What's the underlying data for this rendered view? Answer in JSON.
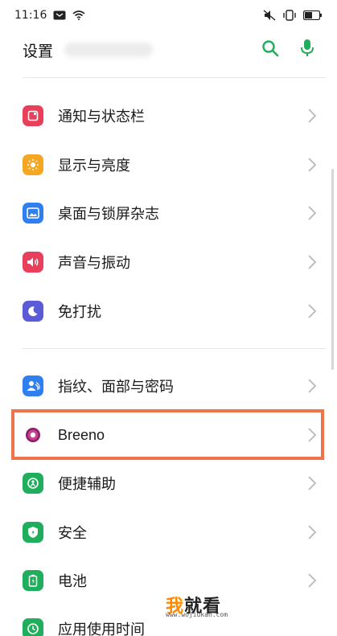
{
  "status_bar": {
    "time": "11:16",
    "icons": [
      "notification-icon",
      "wifi-icon",
      "mute-icon",
      "vibrate-icon",
      "battery-icon"
    ]
  },
  "header": {
    "title": "设置",
    "actions": [
      "search-icon",
      "mic-icon"
    ]
  },
  "accent_color": "#1fae5b",
  "highlight_color": "#f0744a",
  "settings": {
    "group1": [
      {
        "label": "通知与状态栏",
        "icon": "notification-bar-icon",
        "color": "#e8405a"
      },
      {
        "label": "显示与亮度",
        "icon": "sun-icon",
        "color": "#f5a623"
      },
      {
        "label": "桌面与锁屏杂志",
        "icon": "wallpaper-icon",
        "color": "#2f7ff0"
      },
      {
        "label": "声音与振动",
        "icon": "speaker-icon",
        "color": "#e8405a"
      },
      {
        "label": "免打扰",
        "icon": "moon-icon",
        "color": "#5b5bd6"
      }
    ],
    "group2": [
      {
        "label": "指纹、面部与密码",
        "icon": "fingerprint-face-icon",
        "color": "#2f7ff0"
      },
      {
        "label": "Breeno",
        "icon": "breeno-icon",
        "color": "#8a1d6e"
      },
      {
        "label": "便捷辅助",
        "icon": "accessibility-icon",
        "color": "#1fae5b"
      },
      {
        "label": "安全",
        "icon": "shield-icon",
        "color": "#1fae5b"
      },
      {
        "label": "电池",
        "icon": "battery-icon",
        "color": "#1fae5b"
      },
      {
        "label": "应用使用时间",
        "icon": "app-usage-icon",
        "color": "#1fae5b"
      }
    ]
  },
  "watermark": {
    "main_a": "我",
    "main_b": "就看",
    "sub": "www.wojiukan.com"
  }
}
